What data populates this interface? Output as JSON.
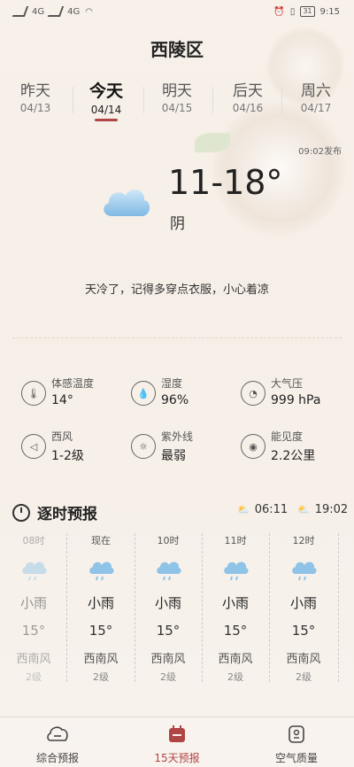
{
  "status": {
    "left": [
      "4G",
      "4G"
    ],
    "battery": "31",
    "time": "9:15"
  },
  "city": "西陵区",
  "days": [
    {
      "name": "昨天",
      "date": "04/13"
    },
    {
      "name": "今天",
      "date": "04/14"
    },
    {
      "name": "明天",
      "date": "04/15"
    },
    {
      "name": "后天",
      "date": "04/16"
    },
    {
      "name": "周六",
      "date": "04/17"
    }
  ],
  "publish": "09:02发布",
  "today": {
    "temp": "11-18°",
    "condition": "阴",
    "icon": "cloud-icon"
  },
  "tip": "天冷了，记得多穿点衣服，小心着凉",
  "metrics": [
    {
      "label": "体感温度",
      "value": "14°",
      "icon": "thermometer-icon"
    },
    {
      "label": "湿度",
      "value": "96%",
      "icon": "droplet-icon"
    },
    {
      "label": "大气压",
      "value": "999 hPa",
      "icon": "gauge-icon"
    },
    {
      "label": "西风",
      "value": "1-2级",
      "icon": "wind-direction-icon"
    },
    {
      "label": "紫外线",
      "value": "最弱",
      "icon": "sun-icon"
    },
    {
      "label": "能见度",
      "value": "2.2公里",
      "icon": "eye-icon"
    }
  ],
  "hourly": {
    "title": "逐时预报",
    "sunrise": "06:11",
    "sunset": "19:02",
    "hours": [
      {
        "time": "08时",
        "weather": "小雨",
        "temp": "15°",
        "wind_dir": "西南风",
        "wind_level": "2级",
        "past": true
      },
      {
        "time": "现在",
        "weather": "小雨",
        "temp": "15°",
        "wind_dir": "西南风",
        "wind_level": "2级",
        "past": false
      },
      {
        "time": "10时",
        "weather": "小雨",
        "temp": "15°",
        "wind_dir": "西南风",
        "wind_level": "2级",
        "past": false
      },
      {
        "time": "11时",
        "weather": "小雨",
        "temp": "15°",
        "wind_dir": "西南风",
        "wind_level": "2级",
        "past": false
      },
      {
        "time": "12时",
        "weather": "小雨",
        "temp": "15°",
        "wind_dir": "西南风",
        "wind_level": "2级",
        "past": false
      }
    ]
  },
  "tabs": [
    {
      "label": "综合预报",
      "icon": "face-cloud-icon"
    },
    {
      "label": "15天预报",
      "icon": "calendar-icon"
    },
    {
      "label": "空气质量",
      "icon": "air-quality-icon"
    }
  ],
  "colors": {
    "accent": "#b04545",
    "background": "#f7f1ea",
    "rain_icon": "#8fc3e8"
  }
}
